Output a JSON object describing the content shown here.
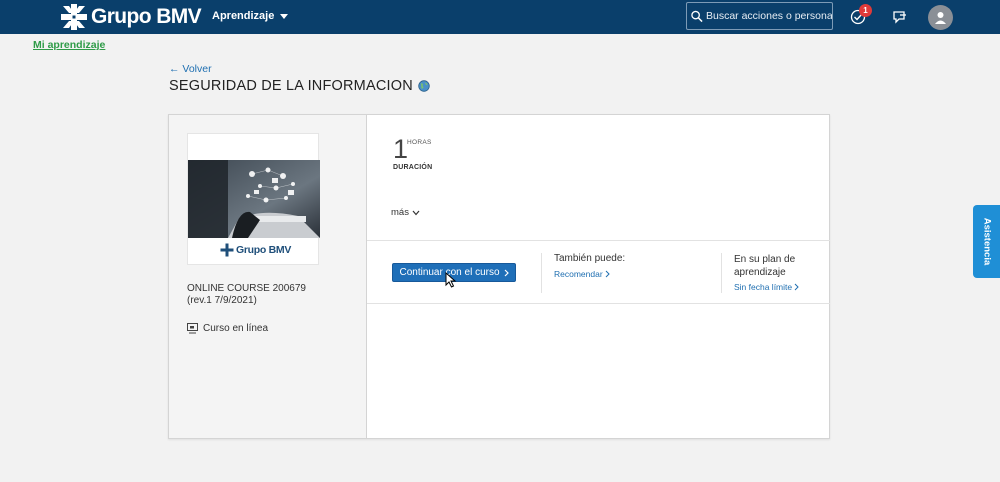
{
  "header": {
    "brand": "Grupo BMV",
    "nav_menu": "Aprendizaje",
    "search_placeholder": "Buscar acciones o personas",
    "notification_count": "1"
  },
  "breadcrumb": "Mi aprendizaje",
  "page": {
    "back_label": "← Volver",
    "title": "SEGURIDAD DE LA INFORMACION"
  },
  "course": {
    "thumbnail_brand": "Grupo BMV",
    "code": "ONLINE COURSE 200679",
    "revision": "(rev.1 7/9/2021)",
    "format": "Curso en línea",
    "duration_value": "1",
    "duration_unit": "HORAS",
    "duration_label": "DURACIÓN",
    "more_label": "más"
  },
  "actions": {
    "continue_label": "Continuar con el curso",
    "also_title": "También puede:",
    "recommend_label": "Recomendar",
    "plan_title": "En su plan de aprendizaje",
    "no_deadline_label": "Sin fecha límite"
  },
  "assist_tab": "Asistencia",
  "colors": {
    "header_bg": "#0a3f6b",
    "primary": "#1f6fb8",
    "link": "#1f6fb1",
    "breadcrumb": "#2e9b47",
    "assist": "#1f8fd6",
    "badge": "#e03a3a"
  },
  "icons": [
    "bmv-logo-icon",
    "search-icon",
    "checkmark-icon",
    "feedback-icon",
    "user-icon",
    "globe-icon",
    "online-course-icon",
    "chevron-down-icon",
    "chevron-right-icon",
    "mouse-cursor-icon"
  ]
}
